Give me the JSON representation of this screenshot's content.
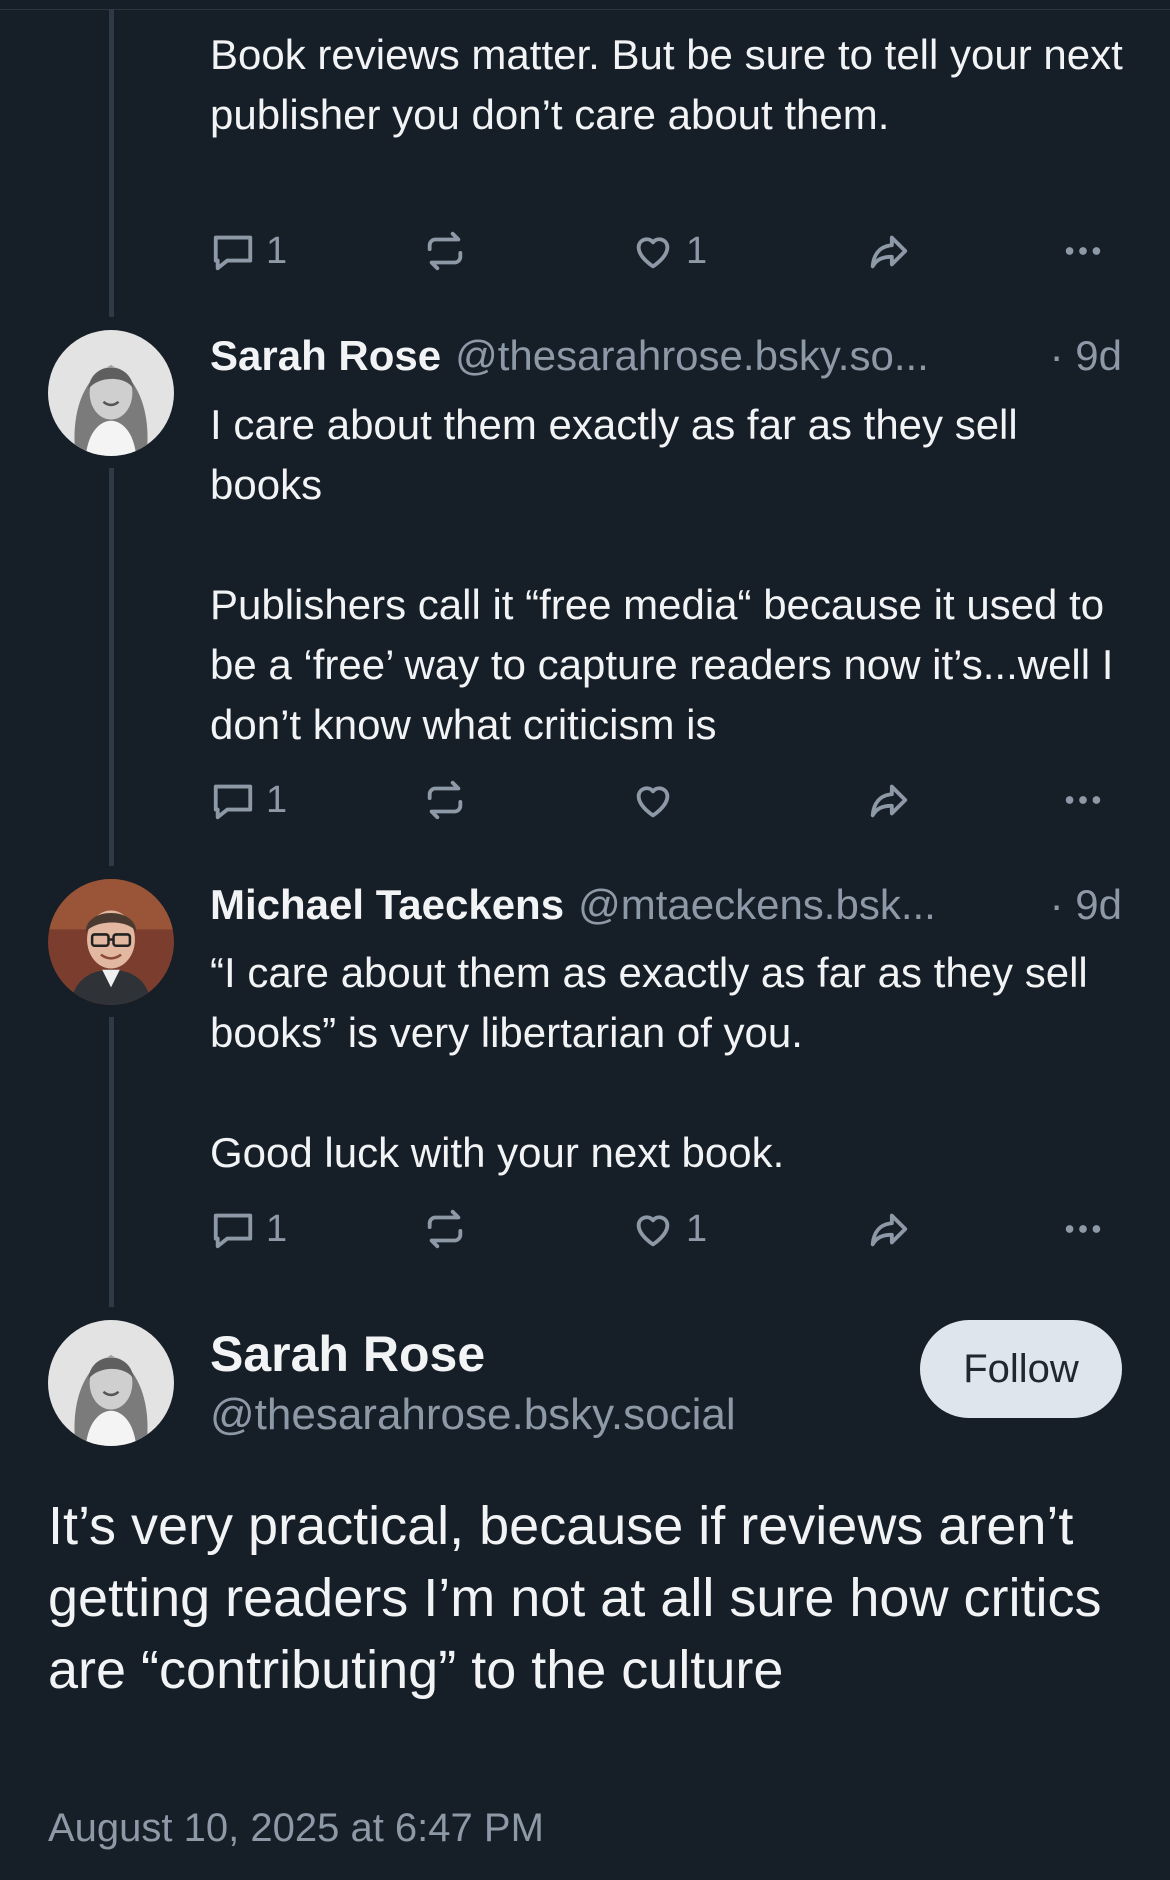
{
  "posts": [
    {
      "text": "Book reviews matter. But be sure to tell your next publisher you don’t care about them.",
      "replies": "1",
      "reposts": "",
      "likes": "1"
    },
    {
      "author": "Sarah Rose",
      "handle": "@thesarahrose.bsky.so...",
      "time": "· 9d",
      "text": "I care about them exactly as far as they sell books\n\nPublishers call it “free media“ because it used to be a ‘free’ way to capture readers now it’s...well I don’t know what criticism is",
      "replies": "1",
      "reposts": "",
      "likes": ""
    },
    {
      "author": "Michael Taeckens",
      "handle": "@mtaeckens.bsk...",
      "time": "· 9d",
      "text": "“I care about them as exactly as far as they sell books” is very libertarian of you.\n\nGood luck with your next book.",
      "replies": "1",
      "reposts": "",
      "likes": "1"
    }
  ],
  "main_post": {
    "author": "Sarah Rose",
    "handle": "@thesarahrose.bsky.social",
    "follow_label": "Follow",
    "text": "It’s very practical, because if reviews aren’t getting readers I’m not at all sure how critics are “contributing” to the culture",
    "date": "August 10, 2025 at 6:47 PM"
  },
  "icons": {
    "reply": "speech-bubble-icon",
    "repost": "repost-arrows-icon",
    "like": "heart-outline-icon",
    "share": "share-arrow-icon",
    "more": "ellipsis-icon"
  },
  "colors": {
    "background": "#161e27",
    "text": "#f1f3f5",
    "muted": "#8d99a6",
    "thread_line": "#2e3a47",
    "follow_button_bg": "#dfe5ec"
  }
}
